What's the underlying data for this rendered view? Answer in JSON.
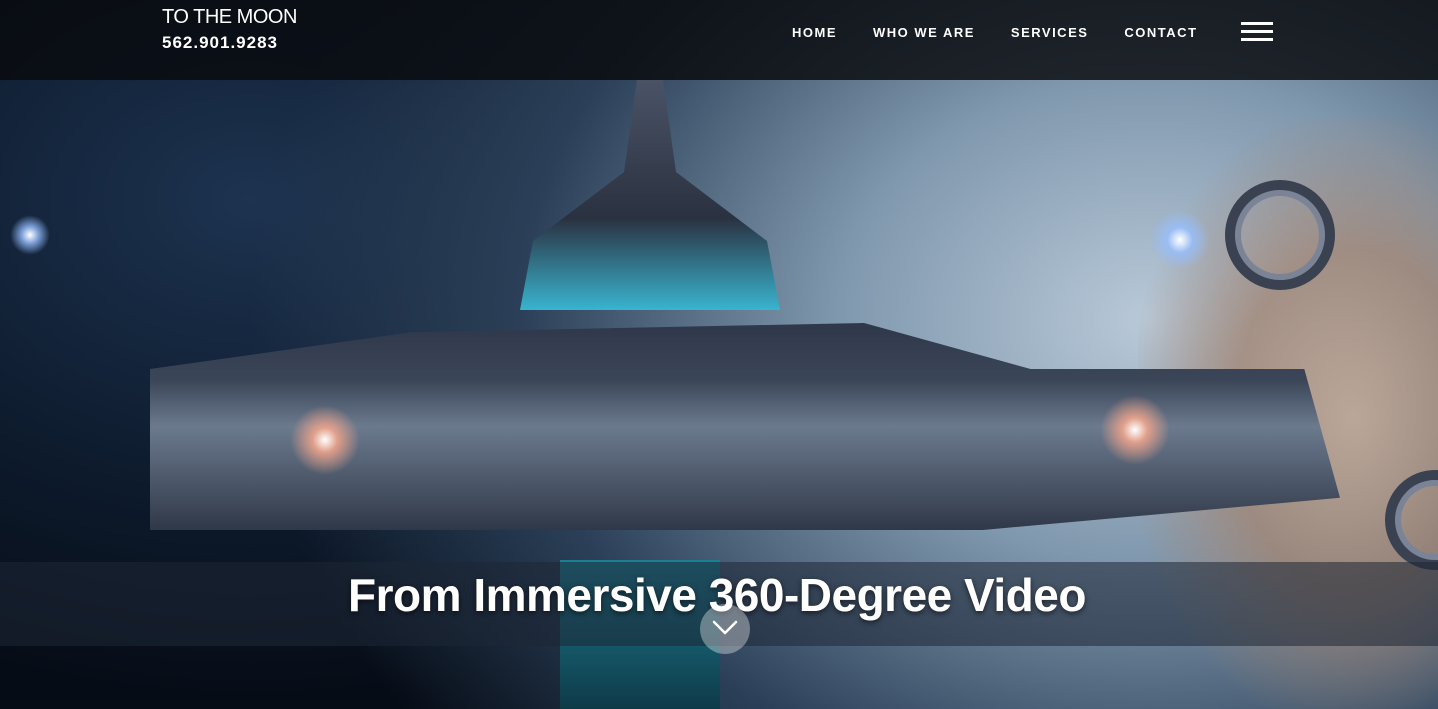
{
  "brand": {
    "name": "TO THE MOON",
    "phone": "562.901.9283"
  },
  "nav": {
    "items": [
      {
        "label": "HOME"
      },
      {
        "label": "WHO WE ARE"
      },
      {
        "label": "SERVICES"
      },
      {
        "label": "CONTACT"
      }
    ],
    "menu_icon": "hamburger-icon"
  },
  "hero": {
    "caption": "From Immersive 360-Degree Video",
    "scroll_icon": "chevron-down-icon"
  }
}
